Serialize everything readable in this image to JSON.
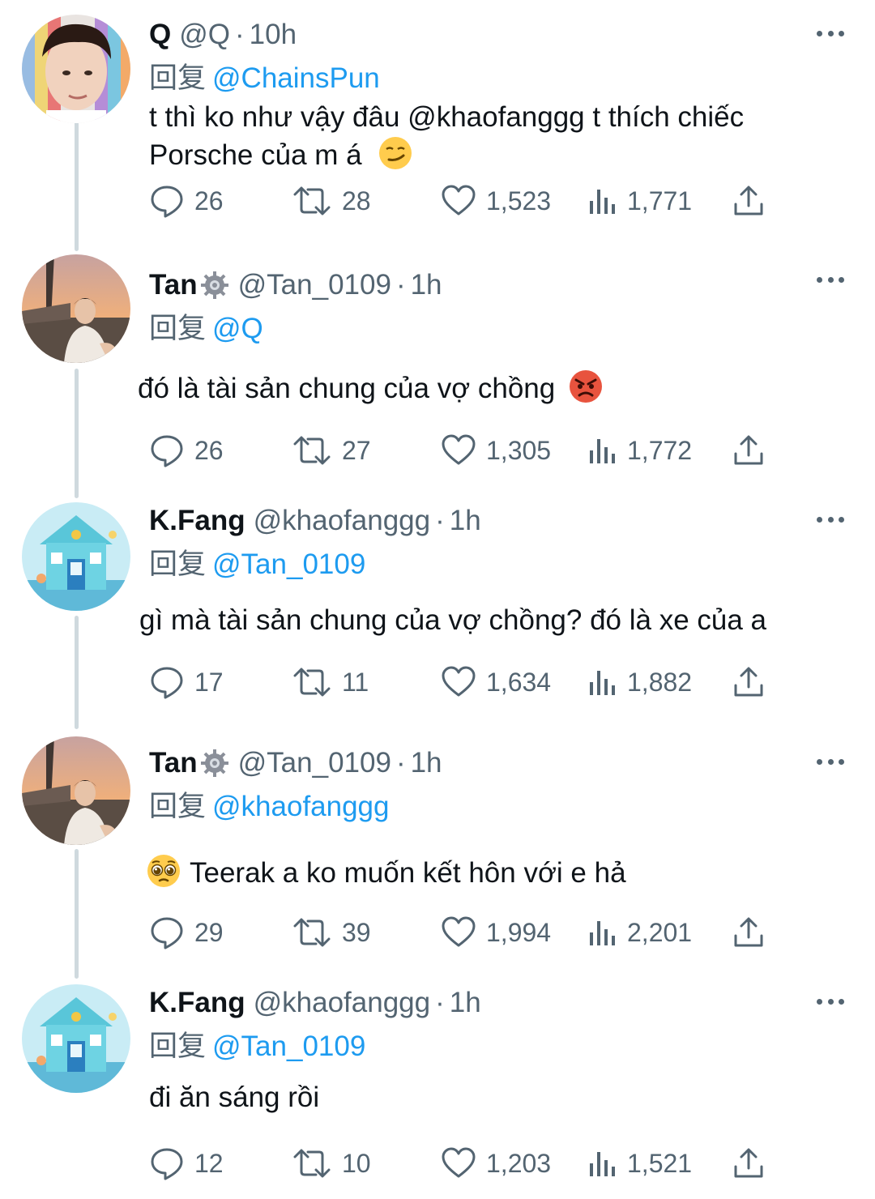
{
  "colors": {
    "accent": "#1d9bf0",
    "muted": "#536471",
    "text": "#0f1419",
    "thread": "#cfd9de"
  },
  "reply_prefix": "回复",
  "tweets": [
    {
      "name": "Q",
      "handle": "@Q",
      "time": "10h",
      "verified_badge": false,
      "reply_to": "@ChainsPun",
      "text_lines": [
        "t thì ko như vậy đâu @khaofanggg t thích chiếc",
        "Porsche của m á"
      ],
      "emoji": "smirk-emoji",
      "stats": {
        "replies": "26",
        "retweets": "28",
        "likes": "1,523",
        "views": "1,771"
      }
    },
    {
      "name": "Tan",
      "handle": "@Tan_0109",
      "time": "1h",
      "verified_badge": true,
      "reply_to": "@Q",
      "text_lines": [
        "đó là tài sản chung của vợ chồng"
      ],
      "emoji": "angry-emoji",
      "stats": {
        "replies": "26",
        "retweets": "27",
        "likes": "1,305",
        "views": "1,772"
      }
    },
    {
      "name": "K.Fang",
      "handle": "@khaofanggg",
      "time": "1h",
      "verified_badge": false,
      "reply_to": "@Tan_0109",
      "text_lines": [
        "gì mà tài sản chung của vợ chồng? đó là xe của a"
      ],
      "emoji": "",
      "stats": {
        "replies": "17",
        "retweets": "11",
        "likes": "1,634",
        "views": "1,882"
      }
    },
    {
      "name": "Tan",
      "handle": "@Tan_0109",
      "time": "1h",
      "verified_badge": true,
      "reply_to": "@khaofanggg",
      "text_lines": [
        "Teerak a ko muốn kết hôn với e hả"
      ],
      "emoji": "pleading-emoji",
      "stats": {
        "replies": "29",
        "retweets": "39",
        "likes": "1,994",
        "views": "2,201"
      }
    },
    {
      "name": "K.Fang",
      "handle": "@khaofanggg",
      "time": "1h",
      "verified_badge": false,
      "reply_to": "@Tan_0109",
      "text_lines": [
        "đi ăn sáng rồi"
      ],
      "emoji": "",
      "stats": {
        "replies": "12",
        "retweets": "10",
        "likes": "1,203",
        "views": "1,521"
      }
    }
  ]
}
